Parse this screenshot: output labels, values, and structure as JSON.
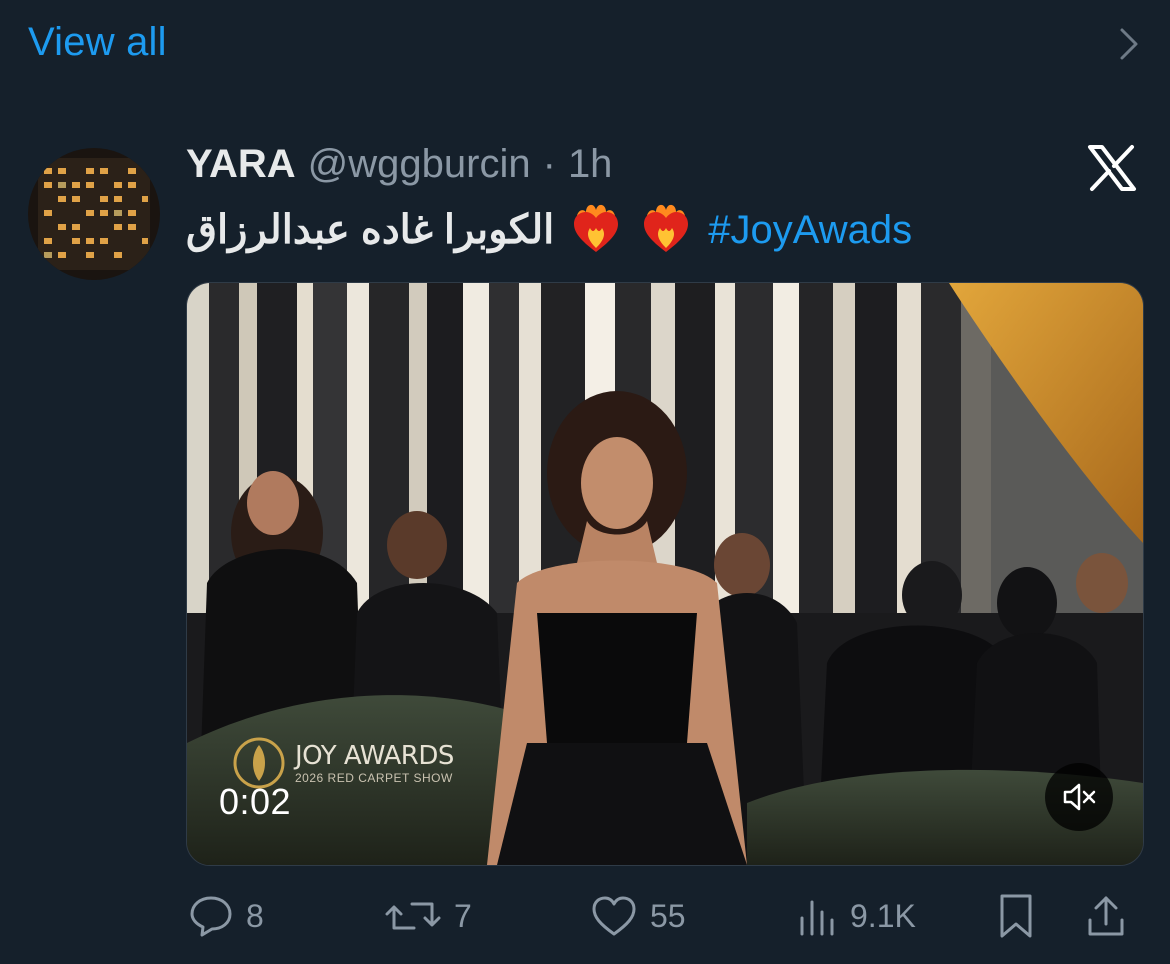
{
  "view_all": {
    "label": "View all"
  },
  "tweet": {
    "display_name": "YARA",
    "handle": "@wggburcin",
    "separator": "·",
    "time": "1h",
    "text_arabic": "الكوبرا غاده عبدالرزاق",
    "hashtag": "#JoyAwads",
    "emoji": [
      "heart-on-fire",
      "heart-on-fire"
    ]
  },
  "media": {
    "watermark_title": "JOY AWARDS",
    "watermark_subtitle": "2026 RED CARPET SHOW",
    "timecode": "0:02",
    "muted": true
  },
  "actions": {
    "replies": "8",
    "reposts": "7",
    "likes": "55",
    "views": "9.1K"
  },
  "colors": {
    "background": "#15202b",
    "accent": "#1d9bf0",
    "secondary_text": "#8b98a5",
    "primary_text": "#e7e9ea"
  },
  "icons": [
    "chevron-right-icon",
    "x-logo-icon",
    "reply-icon",
    "repost-icon",
    "like-icon",
    "views-icon",
    "bookmark-icon",
    "share-icon",
    "mute-icon"
  ]
}
